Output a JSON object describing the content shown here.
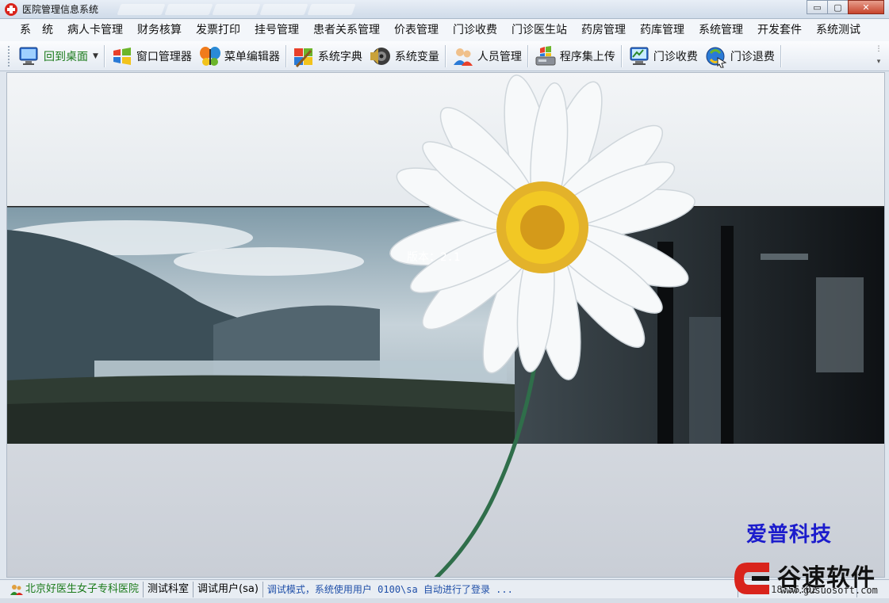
{
  "window": {
    "title": "医院管理信息系统",
    "minimize_label": "▭",
    "maximize_label": "▢",
    "close_label": "✕"
  },
  "menu": {
    "items": [
      "系　统",
      "病人卡管理",
      "财务核算",
      "发票打印",
      "挂号管理",
      "患者关系管理",
      "价表管理",
      "门诊收费",
      "门诊医生站",
      "药房管理",
      "药库管理",
      "系统管理",
      "开发套件",
      "系统测试"
    ]
  },
  "toolbar": {
    "items": [
      {
        "label": "回到桌面",
        "icon": "desktop-icon"
      },
      {
        "label": "窗口管理器",
        "icon": "windows-logo-icon"
      },
      {
        "label": "菜单编辑器",
        "icon": "butterfly-icon"
      },
      {
        "label": "系统字典",
        "icon": "dictionary-icon"
      },
      {
        "label": "系统变量",
        "icon": "speaker-icon"
      },
      {
        "label": "人员管理",
        "icon": "users-icon"
      },
      {
        "label": "程序集上传",
        "icon": "upload-icon"
      },
      {
        "label": "门诊收费",
        "icon": "monitor-icon"
      },
      {
        "label": "门诊退费",
        "icon": "refund-icon"
      }
    ]
  },
  "main": {
    "version_text": "版本：2.1",
    "brand_text": "爱普科技"
  },
  "statusbar": {
    "hospital": "北京好医生女子专科医院",
    "department": "测试科室",
    "user": "调试用户(sa)",
    "message": "调试模式，系统使用用户 0100\\sa 自动进行了登录 ...",
    "datetime": "20   5  18:56:02"
  },
  "watermark": {
    "text": "谷速软件",
    "url": "www.gusuosoft.com"
  },
  "colors": {
    "brand_blue": "#1c1ccc",
    "status_green": "#1a7a1a",
    "status_message": "#1f4fa8"
  }
}
